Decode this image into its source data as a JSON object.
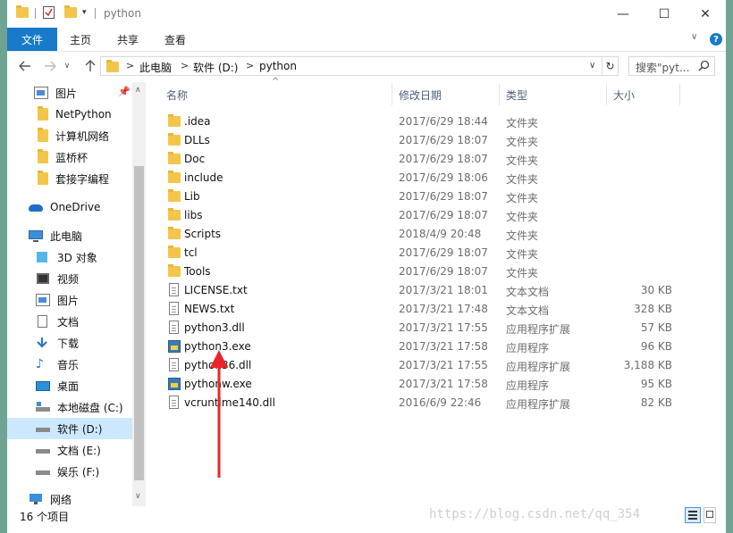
{
  "window": {
    "title": "python",
    "minimize_glyph": "—",
    "maximize_glyph": "☐",
    "close_glyph": "✕"
  },
  "ribbon": {
    "tabs": [
      {
        "label": "文件"
      },
      {
        "label": "主页"
      },
      {
        "label": "共享"
      },
      {
        "label": "查看"
      }
    ],
    "help_glyph": "?"
  },
  "address": {
    "segments": [
      "此电脑",
      "软件 (D:)",
      "python"
    ],
    "separator": ">"
  },
  "search": {
    "placeholder": "搜索\"pyt..."
  },
  "nav_pane": {
    "items": [
      {
        "label": "图片",
        "icon": "pictures-icon",
        "pinned": true
      },
      {
        "label": "NetPython",
        "icon": "folder-icon"
      },
      {
        "label": "计算机网络",
        "icon": "folder-icon"
      },
      {
        "label": "蓝桥杯",
        "icon": "folder-icon"
      },
      {
        "label": "套接字编程",
        "icon": "folder-icon"
      },
      {
        "label": "OneDrive",
        "icon": "onedrive-icon"
      },
      {
        "label": "此电脑",
        "icon": "this-pc-icon"
      },
      {
        "label": "3D 对象",
        "icon": "3d-objects-icon"
      },
      {
        "label": "视频",
        "icon": "videos-icon"
      },
      {
        "label": "图片",
        "icon": "pictures-icon"
      },
      {
        "label": "文档",
        "icon": "documents-icon"
      },
      {
        "label": "下载",
        "icon": "downloads-icon"
      },
      {
        "label": "音乐",
        "icon": "music-icon"
      },
      {
        "label": "桌面",
        "icon": "desktop-icon"
      },
      {
        "label": "本地磁盘 (C:)",
        "icon": "drive-c-icon"
      },
      {
        "label": "软件 (D:)",
        "icon": "drive-icon",
        "selected": true
      },
      {
        "label": "文档 (E:)",
        "icon": "drive-icon"
      },
      {
        "label": "娱乐 (F:)",
        "icon": "drive-icon"
      },
      {
        "label": "网络",
        "icon": "network-icon"
      }
    ]
  },
  "columns": {
    "name": "名称",
    "modified": "修改日期",
    "type": "类型",
    "size": "大小"
  },
  "files": [
    {
      "name": ".idea",
      "modified": "2017/6/29 18:44",
      "type": "文件夹",
      "size": "",
      "icon": "folder-icon"
    },
    {
      "name": "DLLs",
      "modified": "2017/6/29 18:07",
      "type": "文件夹",
      "size": "",
      "icon": "folder-icon"
    },
    {
      "name": "Doc",
      "modified": "2017/6/29 18:07",
      "type": "文件夹",
      "size": "",
      "icon": "folder-icon"
    },
    {
      "name": "include",
      "modified": "2017/6/29 18:06",
      "type": "文件夹",
      "size": "",
      "icon": "folder-icon"
    },
    {
      "name": "Lib",
      "modified": "2017/6/29 18:07",
      "type": "文件夹",
      "size": "",
      "icon": "folder-icon"
    },
    {
      "name": "libs",
      "modified": "2017/6/29 18:07",
      "type": "文件夹",
      "size": "",
      "icon": "folder-icon"
    },
    {
      "name": "Scripts",
      "modified": "2018/4/9 20:48",
      "type": "文件夹",
      "size": "",
      "icon": "folder-icon"
    },
    {
      "name": "tcl",
      "modified": "2017/6/29 18:07",
      "type": "文件夹",
      "size": "",
      "icon": "folder-icon"
    },
    {
      "name": "Tools",
      "modified": "2017/6/29 18:07",
      "type": "文件夹",
      "size": "",
      "icon": "folder-icon"
    },
    {
      "name": "LICENSE.txt",
      "modified": "2017/3/21 18:01",
      "type": "文本文档",
      "size": "30 KB",
      "icon": "text-file-icon"
    },
    {
      "name": "NEWS.txt",
      "modified": "2017/3/21 17:48",
      "type": "文本文档",
      "size": "328 KB",
      "icon": "text-file-icon"
    },
    {
      "name": "python3.dll",
      "modified": "2017/3/21 17:55",
      "type": "应用程序扩展",
      "size": "57 KB",
      "icon": "dll-file-icon"
    },
    {
      "name": "python3.exe",
      "modified": "2017/3/21 17:58",
      "type": "应用程序",
      "size": "96 KB",
      "icon": "python-exe-icon"
    },
    {
      "name": "python36.dll",
      "modified": "2017/3/21 17:55",
      "type": "应用程序扩展",
      "size": "3,188 KB",
      "icon": "dll-file-icon"
    },
    {
      "name": "pythonw.exe",
      "modified": "2017/3/21 17:58",
      "type": "应用程序",
      "size": "95 KB",
      "icon": "python-exe-icon"
    },
    {
      "name": "vcruntime140.dll",
      "modified": "2016/6/9 22:46",
      "type": "应用程序扩展",
      "size": "82 KB",
      "icon": "dll-file-icon"
    }
  ],
  "status": {
    "item_count": "16 个项目"
  },
  "watermark": "https://blog.csdn.net/qq_354",
  "colors": {
    "accent": "#1979ca",
    "selected_bg": "#cce8ff",
    "folder": "#f3c64b",
    "annotation_arrow": "#e8262a"
  }
}
